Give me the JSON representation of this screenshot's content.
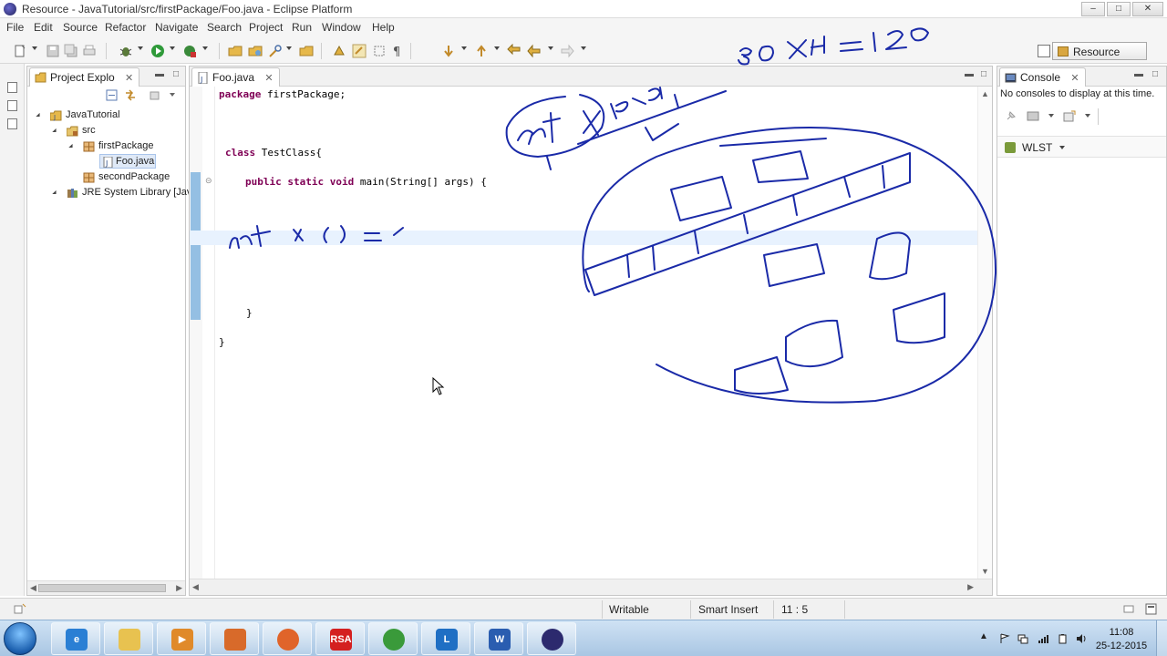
{
  "window": {
    "title": "Resource - JavaTutorial/src/firstPackage/Foo.java - Eclipse Platform",
    "controls": [
      "–",
      "□",
      "✕"
    ]
  },
  "menu": [
    "File",
    "Edit",
    "Source",
    "Refactor",
    "Navigate",
    "Search",
    "Project",
    "Run",
    "Window",
    "Help"
  ],
  "perspective": {
    "label": "Resource"
  },
  "project_explorer": {
    "tab_label": "Project Explo",
    "close": "✕",
    "tree": [
      {
        "label": "JavaTutorial",
        "icon": "project-icon",
        "depth": 0
      },
      {
        "label": "src",
        "icon": "source-folder-icon",
        "depth": 1
      },
      {
        "label": "firstPackage",
        "icon": "package-icon",
        "depth": 2
      },
      {
        "label": "Foo.java",
        "icon": "java-file-icon",
        "depth": 3,
        "selected": true
      },
      {
        "label": "secondPackage",
        "icon": "package-icon",
        "depth": 2
      },
      {
        "label": "JRE System Library [Jav",
        "icon": "library-icon",
        "depth": 1
      }
    ]
  },
  "editor": {
    "tab_label": "Foo.java",
    "close": "✕",
    "lines": [
      {
        "keyword": "package",
        "text": " firstPackage;"
      },
      {
        "keyword": "class",
        "text": " TestClass{"
      },
      {
        "keyword": "public static void",
        "text": " main(String[] args) {"
      },
      {
        "keyword": "",
        "text": "}"
      },
      {
        "keyword": "",
        "text": "}"
      }
    ]
  },
  "console": {
    "tab_label": "Console",
    "close": "✕",
    "message": "No consoles to display at this time.",
    "wlst_label": "WLST"
  },
  "statusbar": {
    "writable": "Writable",
    "insert_mode": "Smart Insert",
    "position": "11 : 5"
  },
  "taskbar": {
    "apps": [
      {
        "name": "internet-explorer-icon",
        "glyph": "e",
        "color": "#2a7fd4"
      },
      {
        "name": "file-explorer-icon",
        "glyph": "",
        "color": "#e8c250"
      },
      {
        "name": "media-player-icon",
        "glyph": "▶",
        "color": "#e08a2a"
      },
      {
        "name": "apps-grid-icon",
        "glyph": "",
        "color": "#d86a2a"
      },
      {
        "name": "firefox-icon",
        "glyph": "",
        "color": "#e0642a"
      },
      {
        "name": "rsa-token-icon",
        "glyph": "RSA",
        "color": "#d42020"
      },
      {
        "name": "chrome-icon",
        "glyph": "",
        "color": "#3a9a3a"
      },
      {
        "name": "lync-icon",
        "glyph": "L",
        "color": "#1f6fc4"
      },
      {
        "name": "word-icon",
        "glyph": "W",
        "color": "#2a5db0"
      },
      {
        "name": "eclipse-icon",
        "glyph": "",
        "color": "#2c2a6e"
      }
    ],
    "clock_time": "11:08",
    "clock_date": "25-12-2015"
  },
  "colors": {
    "ink": "#1a2aa8",
    "keyword": "#7f0055",
    "current_line": "#e8f2fe"
  },
  "handwriting": {
    "top_right": "30X4 = 120",
    "circled": "int x [30],",
    "code_line": "int x [ ] ="
  }
}
